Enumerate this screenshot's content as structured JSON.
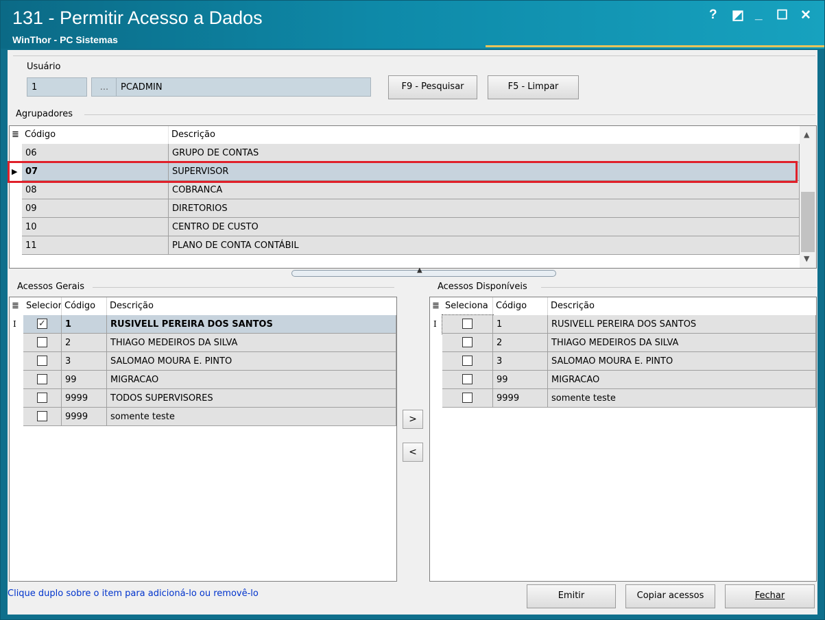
{
  "window": {
    "title": "131 - Permitir Acesso a Dados",
    "subtitle": "WinThor - PC Sistemas",
    "controls": [
      "?",
      "◩",
      "_",
      "☐",
      "✕"
    ]
  },
  "user": {
    "label": "Usuário",
    "code": "1",
    "lookup_button": "...",
    "name": "PCADMIN",
    "search_button": "F9 - Pesquisar",
    "clear_button": "F5 - Limpar"
  },
  "groups": {
    "title": "Agrupadores",
    "columns": [
      "Código",
      "Descrição"
    ],
    "rows": [
      {
        "code": "06",
        "desc": "GRUPO DE CONTAS"
      },
      {
        "code": "07",
        "desc": "SUPERVISOR"
      },
      {
        "code": "08",
        "desc": "COBRANCA"
      },
      {
        "code": "09",
        "desc": "DIRETORIOS"
      },
      {
        "code": "10",
        "desc": "CENTRO DE CUSTO"
      },
      {
        "code": "11",
        "desc": "PLANO DE CONTA CONTÁBIL"
      }
    ],
    "selected_index": 1
  },
  "general": {
    "title": "Acessos Gerais",
    "columns": [
      "Selecior",
      "Código",
      "Descrição"
    ],
    "rows": [
      {
        "checked": true,
        "code": "1",
        "desc": "RUSIVELL PEREIRA DOS SANTOS"
      },
      {
        "checked": false,
        "code": "2",
        "desc": "THIAGO MEDEIROS DA SILVA"
      },
      {
        "checked": false,
        "code": "3",
        "desc": "SALOMAO MOURA E. PINTO"
      },
      {
        "checked": false,
        "code": "99",
        "desc": "MIGRACAO"
      },
      {
        "checked": false,
        "code": "9999",
        "desc": "TODOS SUPERVISORES"
      },
      {
        "checked": false,
        "code": "9999",
        "desc": "somente teste"
      }
    ]
  },
  "available": {
    "title": "Acessos Disponíveis",
    "columns": [
      "Seleciona",
      "Código",
      "Descrição"
    ],
    "rows": [
      {
        "checked": false,
        "code": "1",
        "desc": "RUSIVELL PEREIRA DOS SANTOS"
      },
      {
        "checked": false,
        "code": "2",
        "desc": "THIAGO MEDEIROS DA SILVA"
      },
      {
        "checked": false,
        "code": "3",
        "desc": "SALOMAO MOURA E. PINTO"
      },
      {
        "checked": false,
        "code": "99",
        "desc": "MIGRACAO"
      },
      {
        "checked": false,
        "code": "9999",
        "desc": "somente teste"
      }
    ]
  },
  "move": {
    "add": ">",
    "remove": "<"
  },
  "footer": {
    "hint": "Clique duplo sobre o item para adicioná-lo ou removê-lo",
    "emit_button": "Emitir",
    "copy_button": "Copiar acessos",
    "close_button": "Fechar"
  },
  "colors": {
    "titlebar": "#0e89a8",
    "highlight_box": "#e0202a",
    "hint_text": "#0033cc"
  }
}
